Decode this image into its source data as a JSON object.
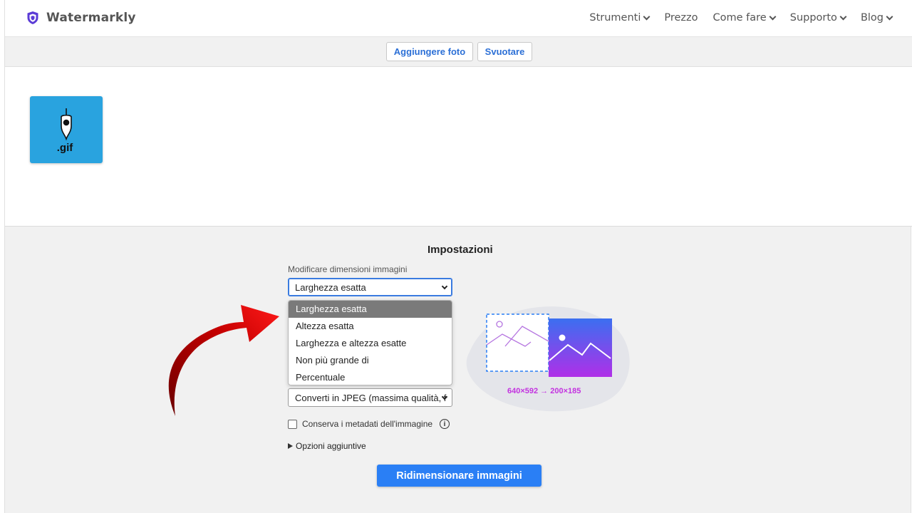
{
  "brand": {
    "name": "Watermarkly",
    "accent": "#5b3bd6"
  },
  "nav": {
    "items": [
      {
        "label": "Strumenti",
        "dropdown": true
      },
      {
        "label": "Prezzo",
        "dropdown": false
      },
      {
        "label": "Come fare",
        "dropdown": true
      },
      {
        "label": "Supporto",
        "dropdown": true
      },
      {
        "label": "Blog",
        "dropdown": true
      }
    ]
  },
  "toolbar": {
    "add_label": "Aggiungere foto",
    "clear_label": "Svuotare"
  },
  "gallery": {
    "items": [
      {
        "thumb_text": ".gif",
        "icon": "gif-file-icon",
        "bg": "#29a3df"
      }
    ]
  },
  "settings": {
    "title": "Impostazioni",
    "resize_label": "Modificare dimensioni immagini",
    "resize_value": "Larghezza esatta",
    "resize_options": [
      "Larghezza esatta",
      "Altezza esatta",
      "Larghezza e altezza esatte",
      "Non più grande di",
      "Percentuale"
    ],
    "selected_option": "Larghezza esatta",
    "format_value": "Converti in JPEG (massima qualità, f",
    "metadata_label": "Conserva i metadati dell'immagine",
    "metadata_checked": false,
    "more_options_label": "Opzioni aggiuntive",
    "submit_label": "Ridimensionare immagini",
    "primary_color": "#2a7ff5"
  },
  "illustration": {
    "caption": "640×592 → 200×185",
    "caption_color": "#c332e0"
  }
}
